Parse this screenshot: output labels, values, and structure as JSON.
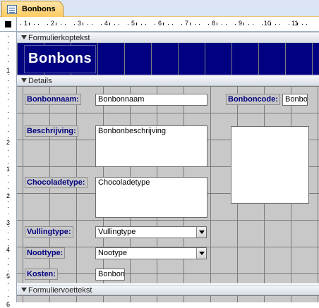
{
  "tab": {
    "title": "Bonbons",
    "icon": "form-icon"
  },
  "ruler": {
    "horizontal": [
      "1",
      "2",
      "3",
      "4",
      "5",
      "6",
      "7",
      "8",
      "9",
      "10",
      "11"
    ],
    "vertical": [
      "1",
      "2",
      "1",
      "2",
      "3",
      "4",
      "5",
      "6",
      "7"
    ]
  },
  "sections": {
    "header": "Formulierkoptekst",
    "detail": "Details",
    "footer": "Formuliervoettekst"
  },
  "header": {
    "title": "Bonbons",
    "background": "#000080"
  },
  "controls": {
    "bonbonnaam": {
      "label": "Bonbonnaam:",
      "value": "Bonbonnaam"
    },
    "bonboncode": {
      "label": "Bonboncode:",
      "value": "Bonbo"
    },
    "beschrijving": {
      "label": "Beschrijving:",
      "value": "Bonbonbeschrijving"
    },
    "chocoladetype": {
      "label": "Chocoladetype:",
      "value": "Chocoladetype"
    },
    "vullingtype": {
      "label": "Vullingtype:",
      "value": "Vullingtype"
    },
    "noottype": {
      "label": "Noottype:",
      "value": "Nootype"
    },
    "kosten": {
      "label": "Kosten:",
      "value": "Bonbon"
    }
  },
  "colors": {
    "label_text": "#000080",
    "grid": "#c8c8c8",
    "accent_tab": "#ffca5e"
  }
}
